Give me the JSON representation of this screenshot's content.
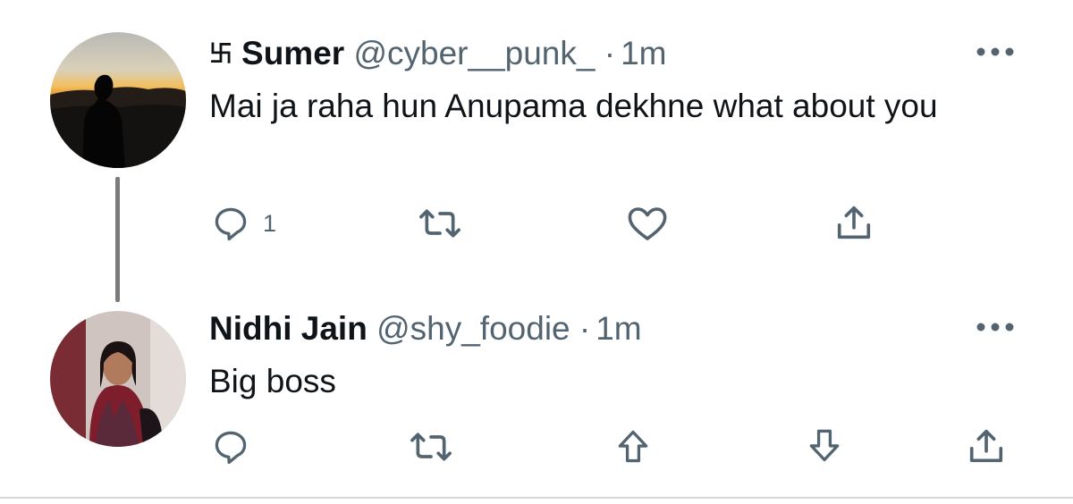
{
  "tweets": [
    {
      "symbol": "卐",
      "name": "Sumer",
      "handle": "@cyber__punk_",
      "separator": "·",
      "time": "1m",
      "text": "Mai ja raha hun Anupama dekhne what about you",
      "reply_count": "1",
      "actions": [
        "reply-icon",
        "retweet-icon",
        "like-icon",
        "share-icon"
      ]
    },
    {
      "name": "Nidhi Jain",
      "handle": "@shy_foodie",
      "separator": "·",
      "time": "1m",
      "text": "Big boss",
      "actions": [
        "reply-icon",
        "retweet-icon",
        "upvote-icon",
        "downvote-icon",
        "share-icon"
      ]
    }
  ],
  "colors": {
    "text": "#0f1419",
    "meta": "#536471",
    "thread_line": "#7b7b7b"
  }
}
